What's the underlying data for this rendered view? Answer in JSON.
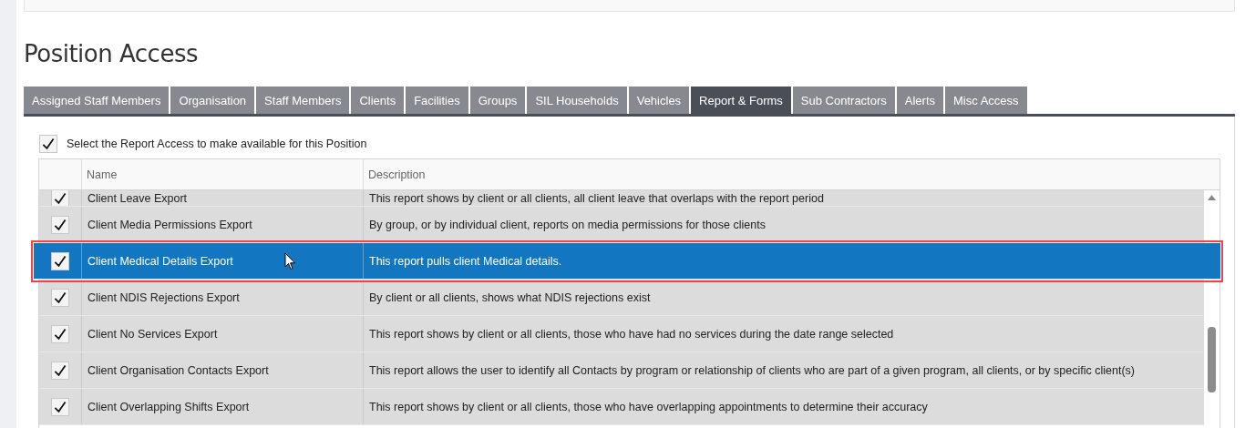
{
  "page": {
    "title": "Position Access"
  },
  "tabs": [
    {
      "label": "Assigned Staff Members",
      "selected": false
    },
    {
      "label": "Organisation",
      "selected": false
    },
    {
      "label": "Staff Members",
      "selected": false
    },
    {
      "label": "Clients",
      "selected": false
    },
    {
      "label": "Facilities",
      "selected": false
    },
    {
      "label": "Groups",
      "selected": false
    },
    {
      "label": "SIL Households",
      "selected": false
    },
    {
      "label": "Vehicles",
      "selected": false
    },
    {
      "label": "Report & Forms",
      "selected": true
    },
    {
      "label": "Sub Contractors",
      "selected": false
    },
    {
      "label": "Alerts",
      "selected": false
    },
    {
      "label": "Misc Access",
      "selected": false
    }
  ],
  "select_all": {
    "label": "Select the Report Access to make available for this Position",
    "checked": true
  },
  "table": {
    "columns": [
      "Name",
      "Description"
    ],
    "rows": [
      {
        "checked": true,
        "selected": false,
        "name": "Client Leave Export",
        "description": "This report shows by client or all clients, all client leave that overlaps with the report period"
      },
      {
        "checked": true,
        "selected": false,
        "name": "Client Media Permissions Export",
        "description": "By group, or by individual client, reports on media permissions for those clients"
      },
      {
        "checked": true,
        "selected": true,
        "name": "Client Medical Details Export",
        "description": "This report pulls client Medical details."
      },
      {
        "checked": true,
        "selected": false,
        "name": "Client NDIS Rejections Export",
        "description": "By client or all clients, shows what NDIS rejections exist"
      },
      {
        "checked": true,
        "selected": false,
        "name": "Client No Services Export",
        "description": "This report shows by client or all clients, those who have had no services during the date range selected"
      },
      {
        "checked": true,
        "selected": false,
        "name": "Client Organisation Contacts Export",
        "description": "This report allows the user to identify all Contacts by program or relationship of clients who are part of a given program, all clients, or by specific client(s)"
      },
      {
        "checked": true,
        "selected": false,
        "name": "Client Overlapping Shifts Export",
        "description": "This report shows by client or all clients, those who have overlapping appointments to determine their accuracy"
      }
    ]
  }
}
